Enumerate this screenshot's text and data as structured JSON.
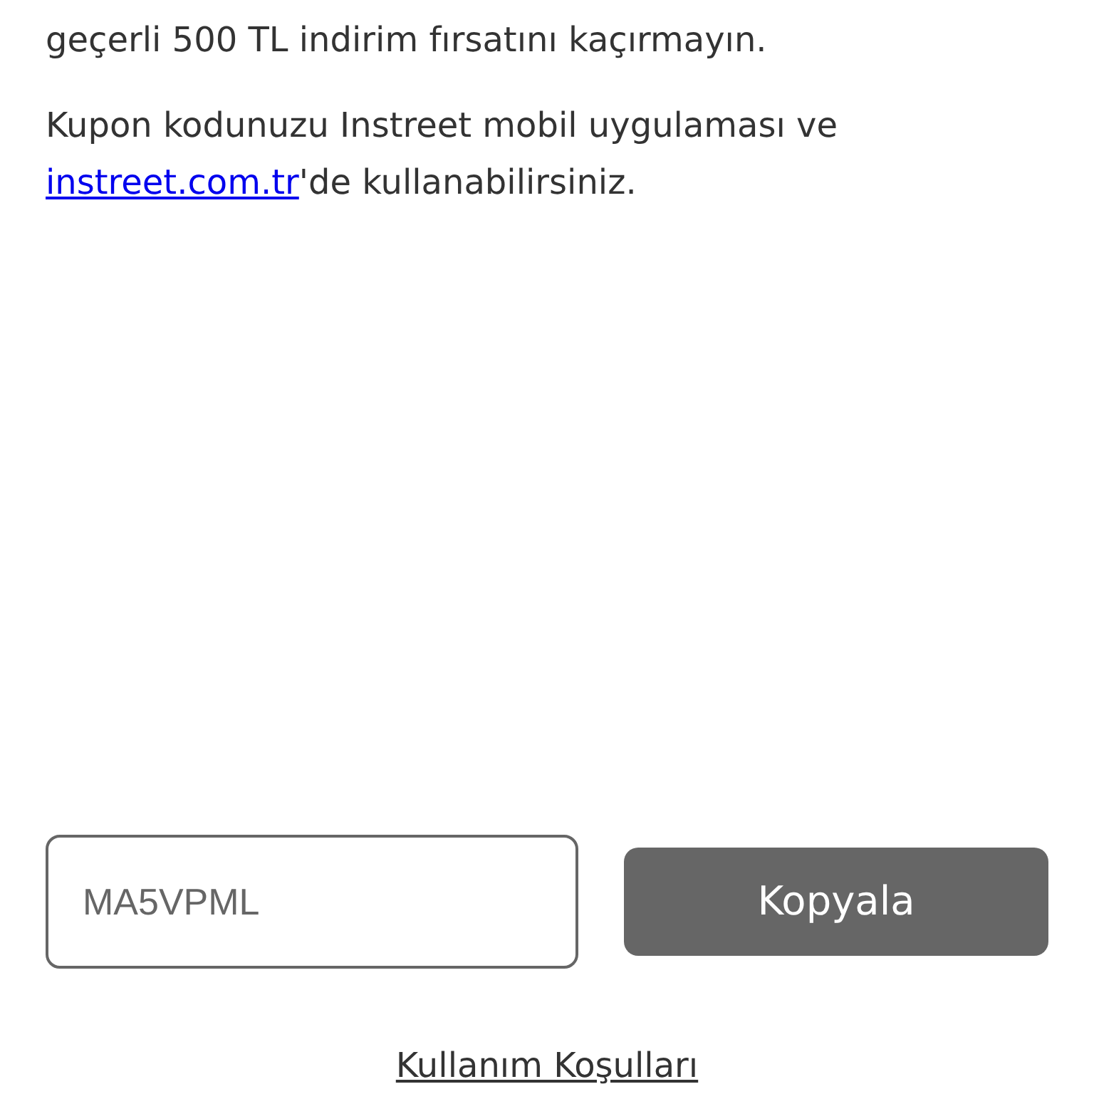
{
  "intro_text": "geçerli 500 TL indirim fırsatını kaçırmayın.",
  "usage_text": {
    "before": "Kupon kodunuzu Instreet mobil uygulaması ve",
    "link": "instreet.com.tr",
    "after": "'de kullanabilirsiniz."
  },
  "coupon_field": {
    "value": "MA5VPML"
  },
  "copy_button": {
    "label": "Kopyala"
  },
  "terms_link": "Kullanım Koşulları"
}
